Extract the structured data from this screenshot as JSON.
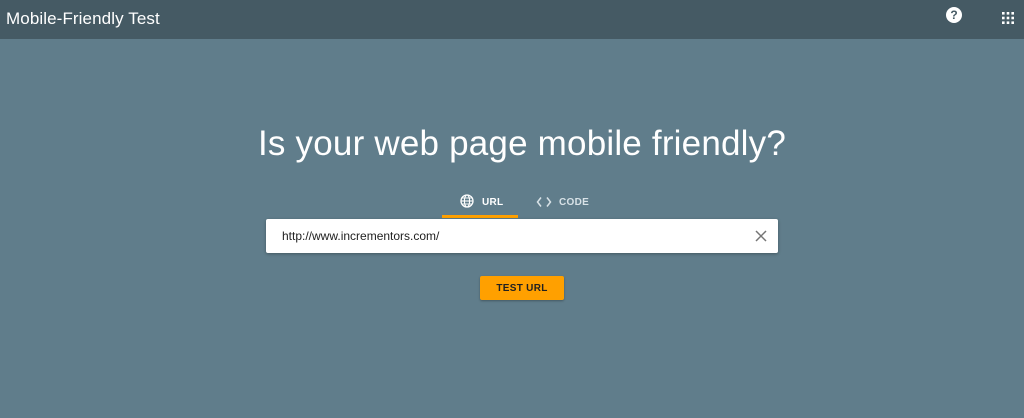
{
  "header": {
    "title": "Mobile-Friendly Test",
    "help_label": "?",
    "help_icon": "help-circle-icon",
    "apps_icon": "apps-grid-icon"
  },
  "main": {
    "headline": "Is your web page mobile friendly?",
    "tabs": [
      {
        "label": "URL",
        "icon": "globe-icon",
        "selected": true
      },
      {
        "label": "CODE",
        "icon": "code-brackets-icon",
        "selected": false
      }
    ],
    "url_input": {
      "value": "http://www.incrementors.com/",
      "placeholder": ""
    },
    "clear_icon": "close-icon",
    "test_button_label": "TEST URL"
  },
  "colors": {
    "header_bg": "#455a64",
    "page_bg": "#607d8b",
    "accent": "#ffa000",
    "text_light": "#ffffff"
  }
}
